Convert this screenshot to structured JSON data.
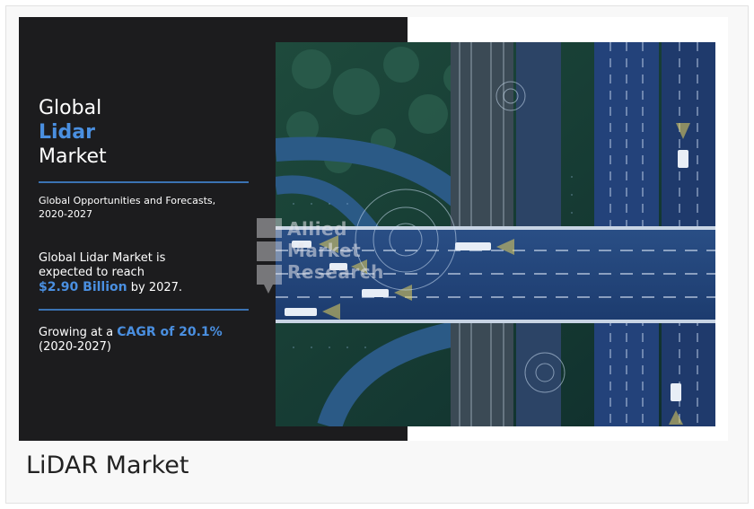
{
  "infographic": {
    "title_line1": "Global",
    "title_line2": "Lidar",
    "title_line3": "Market",
    "subtitle_line1": "Global Opportunities and Forecasts,",
    "subtitle_line2": "2020-2027",
    "stat1_line1": "Global Lidar Market is",
    "stat1_line2": "expected to reach",
    "stat1_value": "$2.90 Billion",
    "stat1_suffix": " by 2027.",
    "stat2_prefix": "Growing at a ",
    "stat2_value": "CAGR of 20.1%",
    "stat2_line2": "(2020-2027)",
    "watermark_line1": "Allied",
    "watermark_line2": "Market",
    "watermark_line3": "Research"
  },
  "caption": "LiDAR Market",
  "colors": {
    "accent": "#4a8fe0",
    "panel": "#1c1c1e",
    "rule": "#3b73b3"
  }
}
